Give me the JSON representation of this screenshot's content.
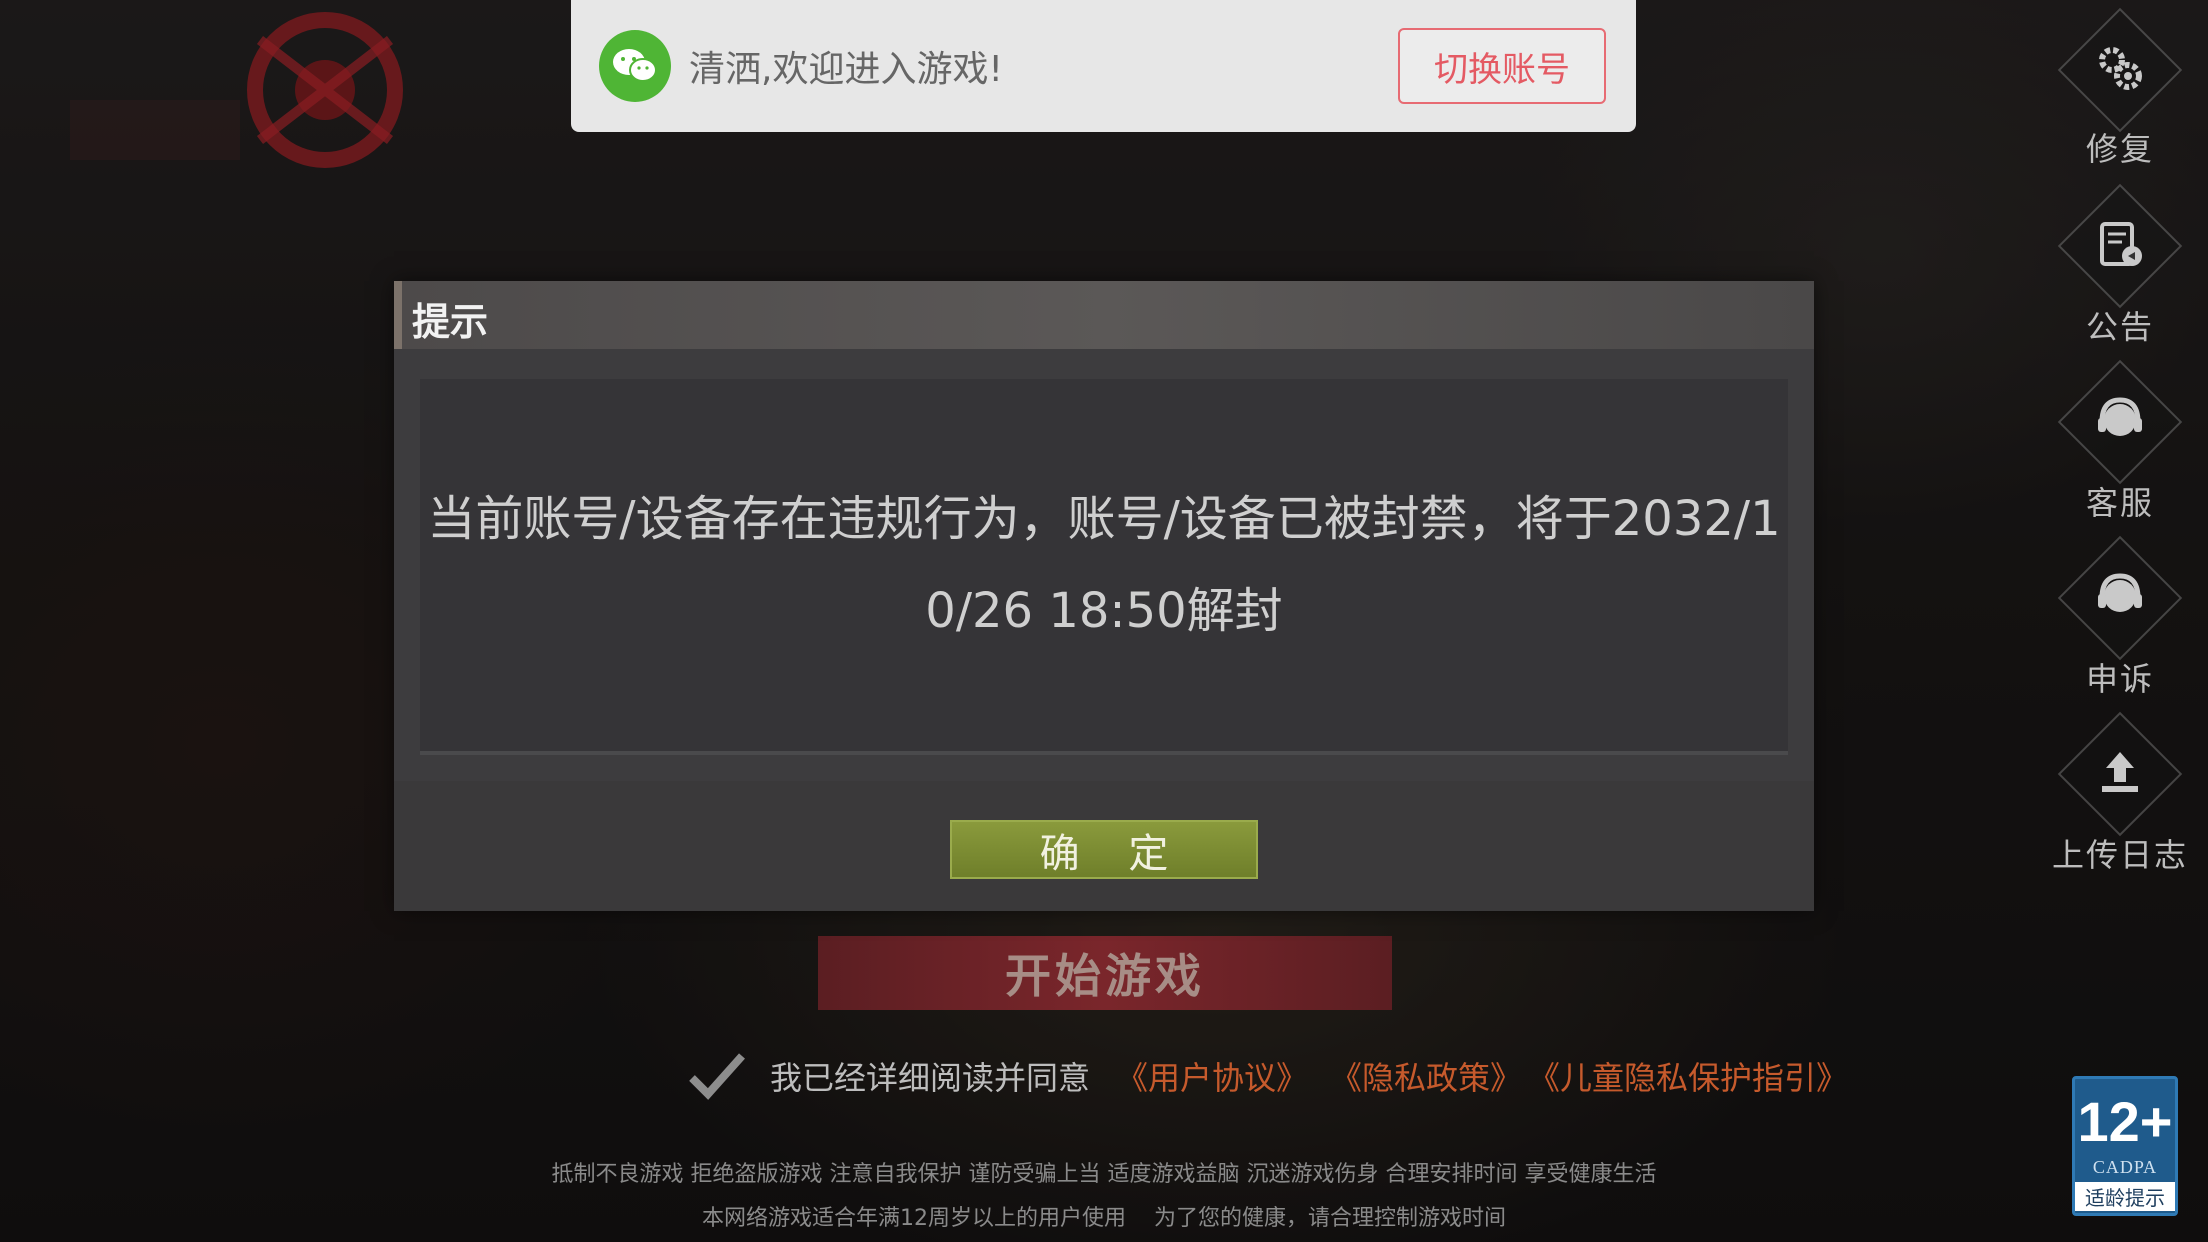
{
  "toast": {
    "message": "清洒,欢迎进入游戏!",
    "switch_account": "切换账号",
    "icon": "wechat-icon"
  },
  "side_menu": [
    {
      "label": "修复",
      "icon": "gears-icon"
    },
    {
      "label": "公告",
      "icon": "announcement-icon"
    },
    {
      "label": "客服",
      "icon": "customer-service-icon"
    },
    {
      "label": "申诉",
      "icon": "appeal-icon"
    },
    {
      "label": "上传日志",
      "icon": "upload-icon"
    }
  ],
  "dialog": {
    "title": "提示",
    "message": "当前账号/设备存在违规行为，账号/设备已被封禁，将于2032/10/26 18:50解封",
    "confirm": "确 定"
  },
  "start_button": "开始游戏",
  "agreement": {
    "prefix": "我已经详细阅读并同意",
    "user_agreement": "《用户协议》",
    "privacy_policy": "《隐私政策》",
    "child_privacy": "《儿童隐私保护指引》",
    "checked": true
  },
  "health_notice": {
    "line1": "抵制不良游戏 拒绝盗版游戏 注意自我保护 谨防受骗上当 适度游戏益脑 沉迷游戏伤身 合理安排时间 享受健康生活",
    "line2": "本网络游戏适合年满12周岁以上的用户使用    为了您的健康，请合理控制游戏时间"
  },
  "age_rating": {
    "age": "12+",
    "org": "CADPA",
    "label": "适龄提示"
  },
  "colors": {
    "accent_red": "#e45a63",
    "confirm_green": "#7a8a32",
    "link_orange": "#c65a2c",
    "wechat_green": "#4fb535"
  }
}
